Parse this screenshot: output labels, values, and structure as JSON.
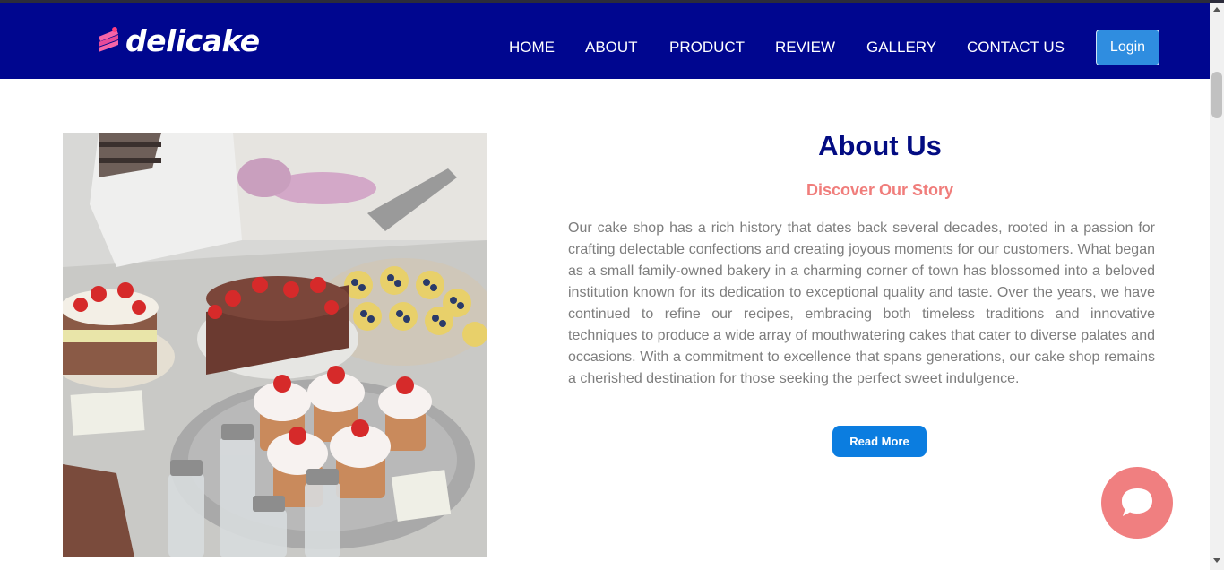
{
  "brand": {
    "name": "delicake"
  },
  "nav": {
    "items": [
      {
        "label": "HOME"
      },
      {
        "label": "ABOUT"
      },
      {
        "label": "PRODUCT"
      },
      {
        "label": "REVIEW"
      },
      {
        "label": "GALLERY"
      },
      {
        "label": "CONTACT US"
      }
    ],
    "login_label": "Login"
  },
  "about": {
    "title": "About Us",
    "subtitle": "Discover Our Story",
    "paragraph": "Our cake shop has a rich history that dates back several decades, rooted in a passion for crafting delectable confections and creating joyous moments for our customers. What began as a small family-owned bakery in a charming corner of town has blossomed into a beloved institution known for its dedication to exceptional quality and taste. Over the years, we have continued to refine our recipes, embracing both timeless traditions and innovative techniques to produce a wide array of mouthwatering cakes that cater to diverse palates and occasions. With a commitment to excellence that spans generations, our cake shop remains a cherished destination for those seeking the perfect sweet indulgence.",
    "read_more_label": "Read More"
  },
  "icons": {
    "logo": "cake-slice-icon",
    "chat": "chat-bubble-icon"
  },
  "colors": {
    "navbar": "#00068f",
    "title": "#020b82",
    "subtitle": "#f07d7b",
    "read_more": "#0b7de0",
    "login": "#2f8de0",
    "chat": "#f07f80"
  }
}
